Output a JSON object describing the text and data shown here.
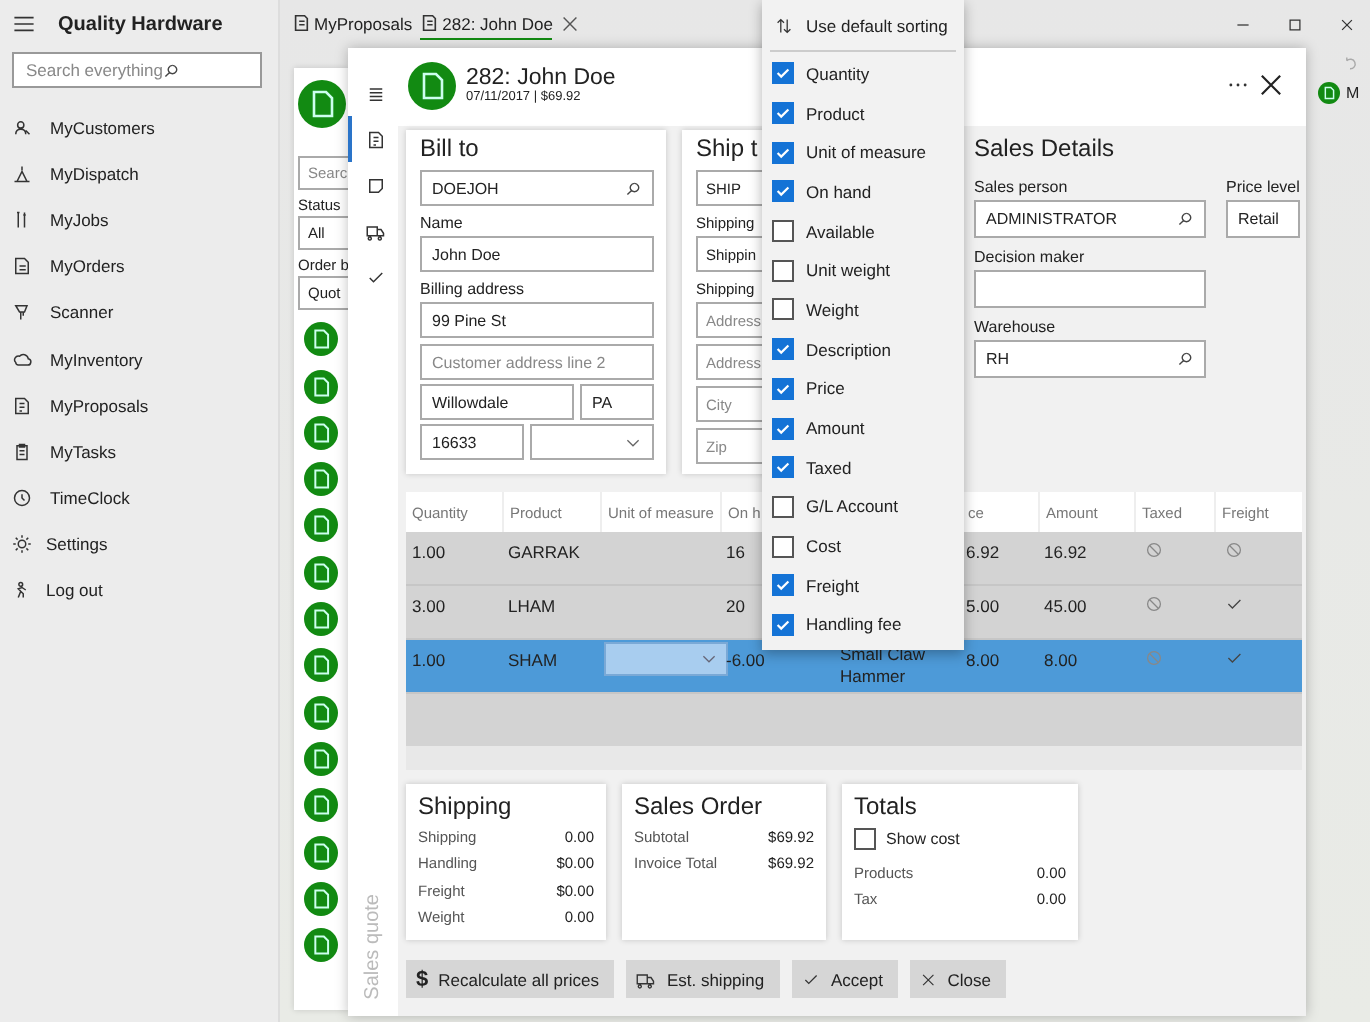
{
  "sidebar": {
    "title": "Quality Hardware",
    "search": {
      "placeholder": "Search everything"
    },
    "items": [
      {
        "label": "MyCustomers"
      },
      {
        "label": "MyDispatch"
      },
      {
        "label": "MyJobs"
      },
      {
        "label": "MyOrders"
      },
      {
        "label": "Scanner"
      },
      {
        "label": "MyInventory"
      },
      {
        "label": "MyProposals"
      },
      {
        "label": "MyTasks"
      },
      {
        "label": "TimeClock"
      }
    ],
    "footer": [
      {
        "label": "Settings"
      },
      {
        "label": "Log out"
      }
    ]
  },
  "tabs": [
    {
      "label": "MyProposals",
      "selected": false
    },
    {
      "label": "282: John Doe",
      "selected": true
    }
  ],
  "list_panel": {
    "search": {
      "placeholder": "Searc"
    },
    "status_label": "Status",
    "status_value": "All",
    "order_label": "Order b",
    "order_value": "Quot",
    "items": [
      {
        "kind": "proposal"
      },
      {
        "kind": "proposal"
      },
      {
        "kind": "proposal"
      },
      {
        "kind": "proposal"
      },
      {
        "kind": "proposal"
      },
      {
        "kind": "proposal"
      },
      {
        "kind": "proposal"
      },
      {
        "kind": "proposal"
      },
      {
        "kind": "proposal"
      },
      {
        "kind": "proposal"
      },
      {
        "kind": "proposal"
      },
      {
        "kind": "proposal"
      },
      {
        "kind": "proposal"
      },
      {
        "kind": "proposal"
      }
    ]
  },
  "avatar": {
    "initial": "M"
  },
  "dialog": {
    "rail": [
      {
        "selected": false
      },
      {
        "selected": true
      },
      {
        "selected": false
      },
      {
        "selected": false
      },
      {
        "selected": false
      }
    ],
    "title": "282: John Doe",
    "subtitle": "07/11/2017 | $69.92",
    "side_label": "Sales quote",
    "bill_to": {
      "heading": "Bill to",
      "customer": "DOEJOH",
      "name_label": "Name",
      "name": "John Doe",
      "address_label": "Billing address",
      "address1": "99 Pine St",
      "address2_placeholder": "Customer address line 2",
      "city": "Willowdale",
      "state": "PA",
      "zip": "16633"
    },
    "ship_to": {
      "heading": "Ship t",
      "code": "SHIP",
      "label_1": "Shipping",
      "value_1": "Shippin",
      "label_2": "Shipping",
      "address1_placeholder": "Address",
      "address2_placeholder": "Address",
      "city_placeholder": "City",
      "zip_placeholder": "Zip"
    },
    "sales_details": {
      "heading": "Sales Details",
      "person_label": "Sales person",
      "person": "ADMINISTRATOR",
      "price_level_label": "Price level",
      "price_level": "Retail",
      "decision_label": "Decision maker",
      "warehouse_label": "Warehouse",
      "warehouse": "RH"
    },
    "table": {
      "columns": [
        {
          "label": "Quantity"
        },
        {
          "label": "Product"
        },
        {
          "label": "Unit of measure"
        },
        {
          "label": "On h"
        },
        {},
        {
          "label": "ce"
        },
        {
          "label": "Amount"
        },
        {
          "label": "Taxed"
        },
        {
          "label": "Freight"
        }
      ],
      "rows": [
        {
          "quantity": "1.00",
          "product": "GARRAK",
          "on_hand": "16",
          "price": "6.92",
          "amount": "16.92",
          "taxed": false,
          "freight": false,
          "selected": false
        },
        {
          "quantity": "3.00",
          "product": "LHAM",
          "on_hand": "20",
          "price": "5.00",
          "amount": "45.00",
          "taxed": false,
          "freight": true,
          "selected": false
        },
        {
          "quantity": "1.00",
          "product": "SHAM",
          "on_hand": "-6.00",
          "description": "Small Claw Hammer",
          "price": "8.00",
          "amount": "8.00",
          "taxed": false,
          "freight": true,
          "selected": true
        }
      ]
    },
    "shipping": {
      "heading": "Shipping",
      "rows": [
        {
          "label": "Shipping",
          "value": "0.00"
        },
        {
          "label": "Handling",
          "value": "$0.00"
        },
        {
          "label": "Freight",
          "value": "$0.00"
        },
        {
          "label": "Weight",
          "value": "0.00"
        }
      ]
    },
    "sales_order": {
      "heading": "Sales Order",
      "rows": [
        {
          "label": "Subtotal",
          "value": "$69.92"
        },
        {
          "label": "Invoice Total",
          "value": "$69.92"
        }
      ]
    },
    "totals": {
      "heading": "Totals",
      "show_cost": {
        "label": "Show cost",
        "checked": false
      },
      "rows": [
        {
          "label": "Products",
          "value": "0.00"
        },
        {
          "label": "Tax",
          "value": "0.00"
        }
      ]
    },
    "buttons": [
      {
        "label": "Recalculate all prices",
        "glyph": "$"
      },
      {
        "label": "Est. shipping"
      },
      {
        "label": "Accept"
      },
      {
        "label": "Close"
      }
    ]
  },
  "column_menu": {
    "sort_label": "Use default sorting",
    "items": [
      {
        "label": "Quantity",
        "checked": true
      },
      {
        "label": "Product",
        "checked": true
      },
      {
        "label": "Unit of measure",
        "checked": true
      },
      {
        "label": "On hand",
        "checked": true
      },
      {
        "label": "Available",
        "checked": false
      },
      {
        "label": "Unit weight",
        "checked": false
      },
      {
        "label": "Weight",
        "checked": false
      },
      {
        "label": "Description",
        "checked": true
      },
      {
        "label": "Price",
        "checked": true
      },
      {
        "label": "Amount",
        "checked": true
      },
      {
        "label": "Taxed",
        "checked": true
      },
      {
        "label": "G/L Account",
        "checked": false
      },
      {
        "label": "Cost",
        "checked": false
      },
      {
        "label": "Freight",
        "checked": true
      },
      {
        "label": "Handling fee",
        "checked": true
      }
    ]
  }
}
